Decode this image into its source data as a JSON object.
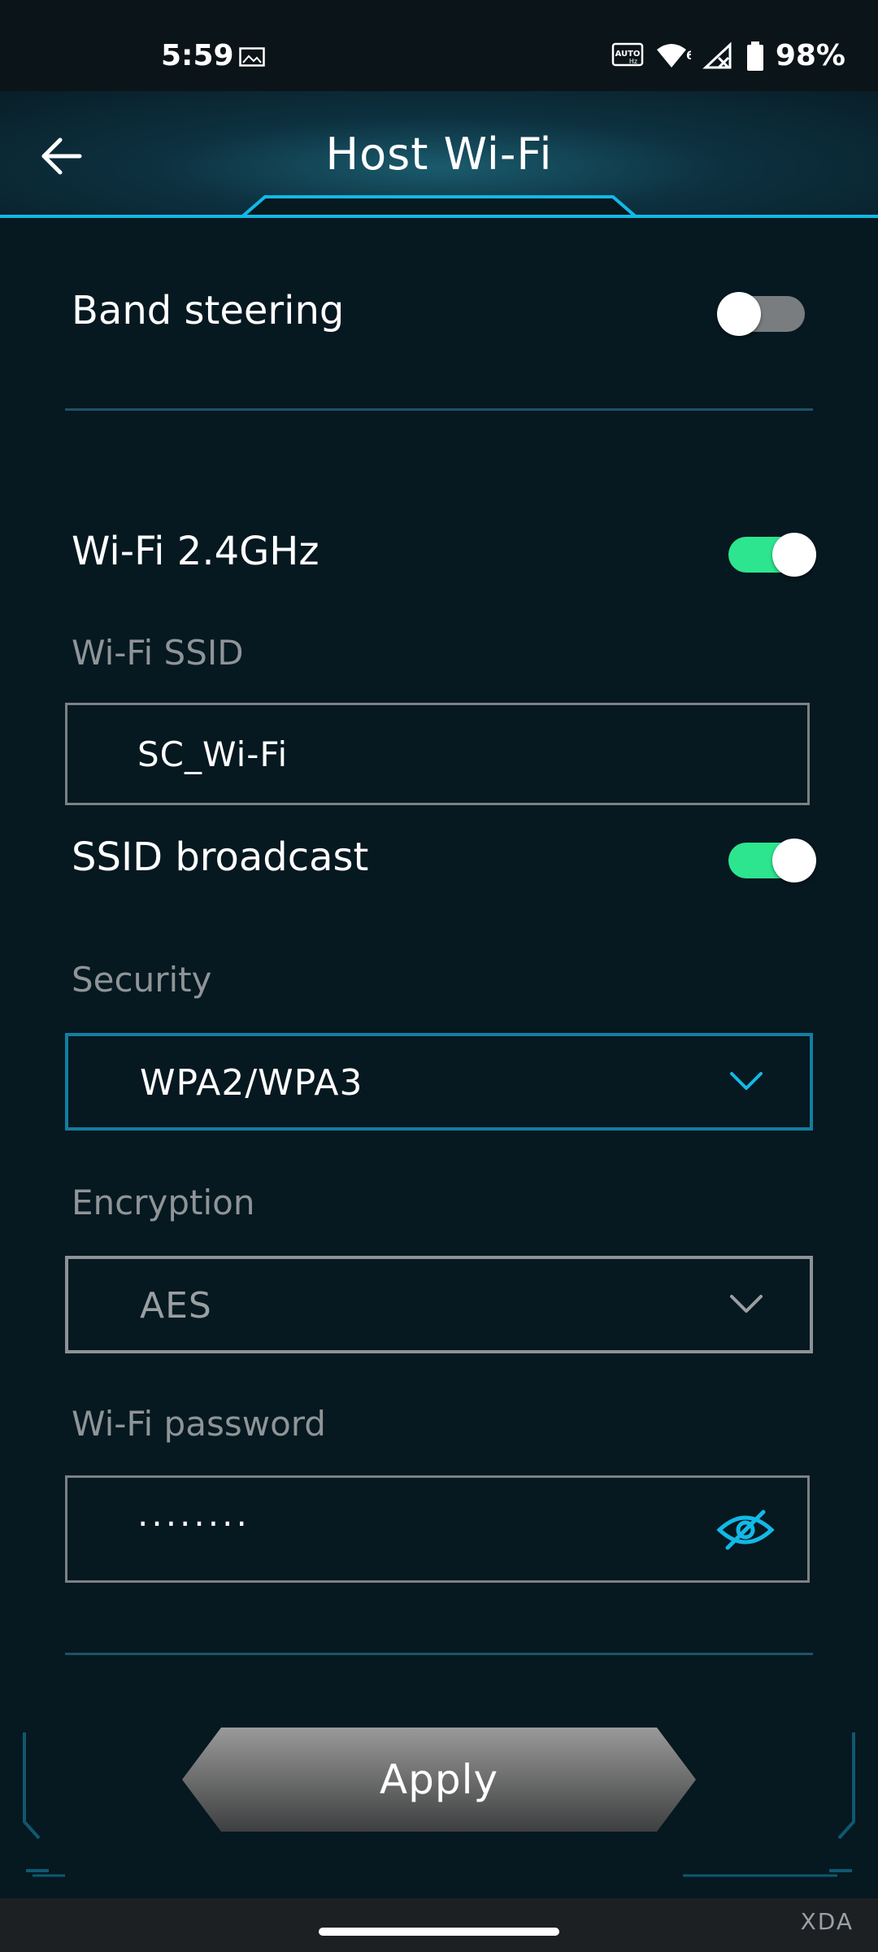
{
  "status_bar": {
    "time": "5:59",
    "battery": "98%",
    "icons": [
      "image-icon",
      "auto-hz-icon",
      "wifi-6-icon",
      "no-signal-icon",
      "battery-icon"
    ]
  },
  "header": {
    "title": "Host Wi-Fi",
    "back_icon": "arrow-left-icon"
  },
  "band_steering": {
    "label": "Band steering",
    "enabled": false
  },
  "wifi_24": {
    "label": "Wi-Fi 2.4GHz",
    "enabled": true
  },
  "ssid": {
    "label": "Wi-Fi SSID",
    "value": "SC_Wi-Fi"
  },
  "ssid_broadcast": {
    "label": "SSID broadcast",
    "enabled": true
  },
  "security": {
    "label": "Security",
    "value": "WPA2/WPA3"
  },
  "encryption": {
    "label": "Encryption",
    "value": "AES"
  },
  "password": {
    "label": "Wi-Fi password",
    "value": "········",
    "eye_icon": "eye-hidden-icon"
  },
  "apply": {
    "label": "Apply"
  },
  "watermark": "XDA",
  "colors": {
    "background": "#061820",
    "accent": "#12b9e6",
    "toggle_on": "#2de58e",
    "toggle_off": "#7a7d7f"
  }
}
